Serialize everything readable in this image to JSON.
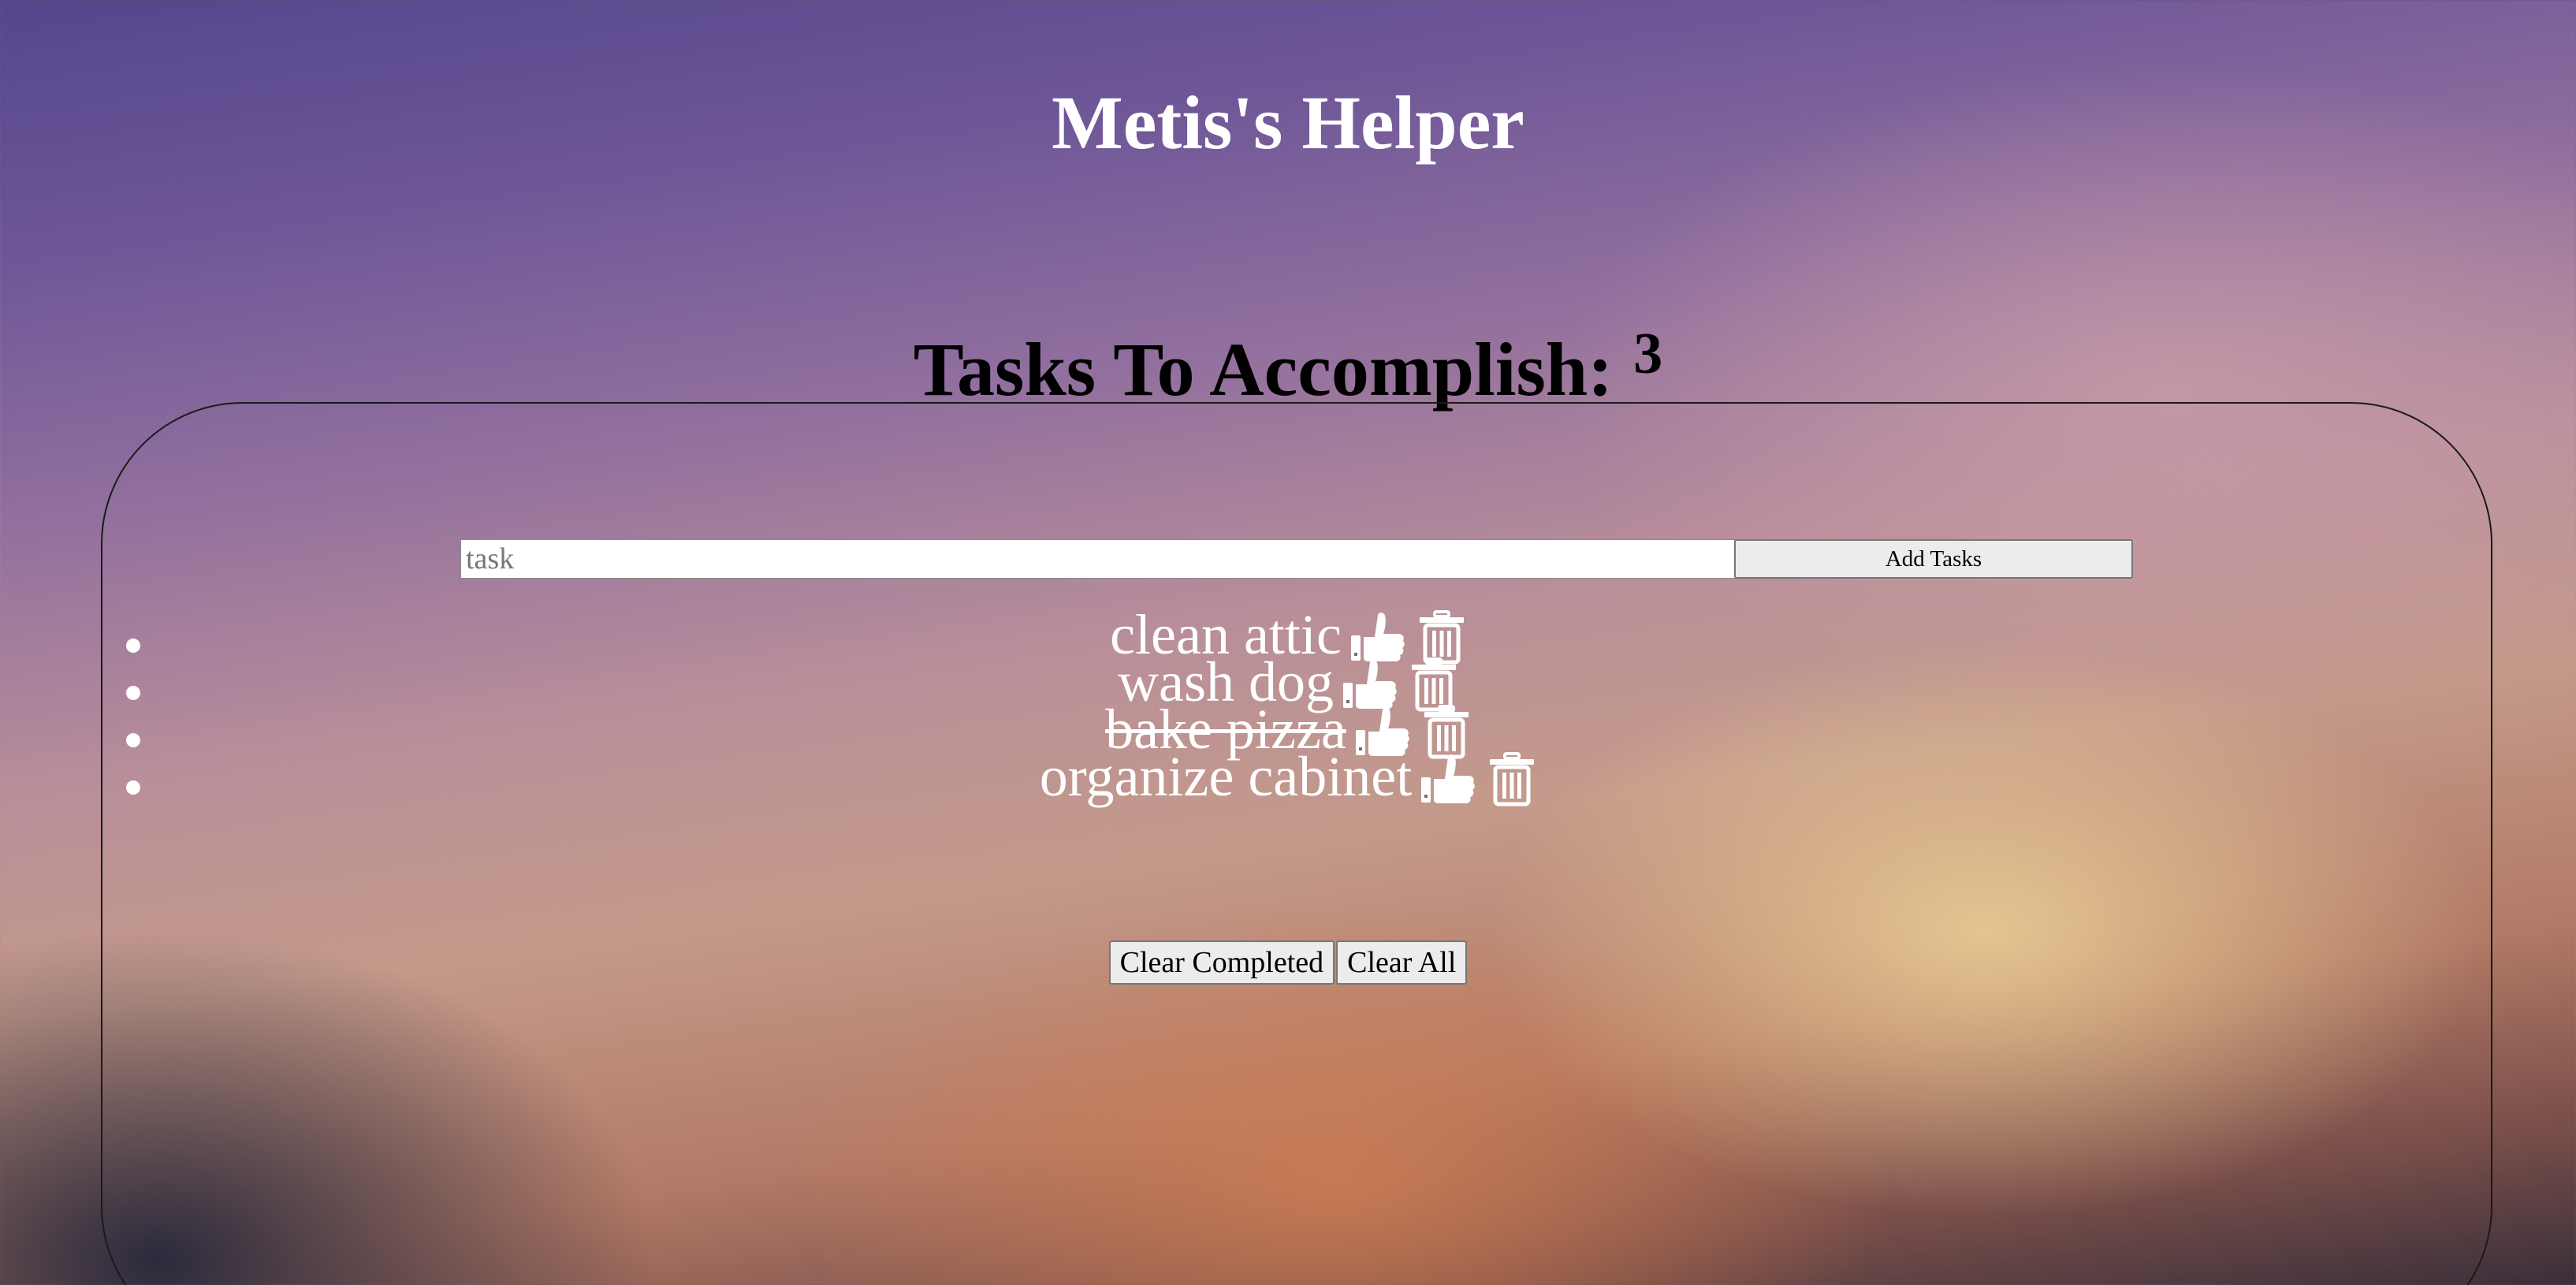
{
  "app": {
    "title": "Metis's Helper"
  },
  "tasks_section": {
    "heading": "Tasks To Accomplish:",
    "count": "3"
  },
  "form": {
    "input_placeholder": "task",
    "input_value": "",
    "add_label": "Add Tasks"
  },
  "tasks": [
    {
      "text": "clean attic",
      "completed": false
    },
    {
      "text": "wash dog",
      "completed": false
    },
    {
      "text": "bake pizza",
      "completed": true
    },
    {
      "text": "organize cabinet",
      "completed": false
    }
  ],
  "actions": {
    "clear_completed_label": "Clear Completed",
    "clear_all_label": "Clear All"
  },
  "icons": {
    "complete": "thumbs-up-icon",
    "delete": "trash-icon"
  },
  "colors": {
    "title": "#ffffff",
    "heading": "#000000",
    "task_text": "#ffffff"
  }
}
